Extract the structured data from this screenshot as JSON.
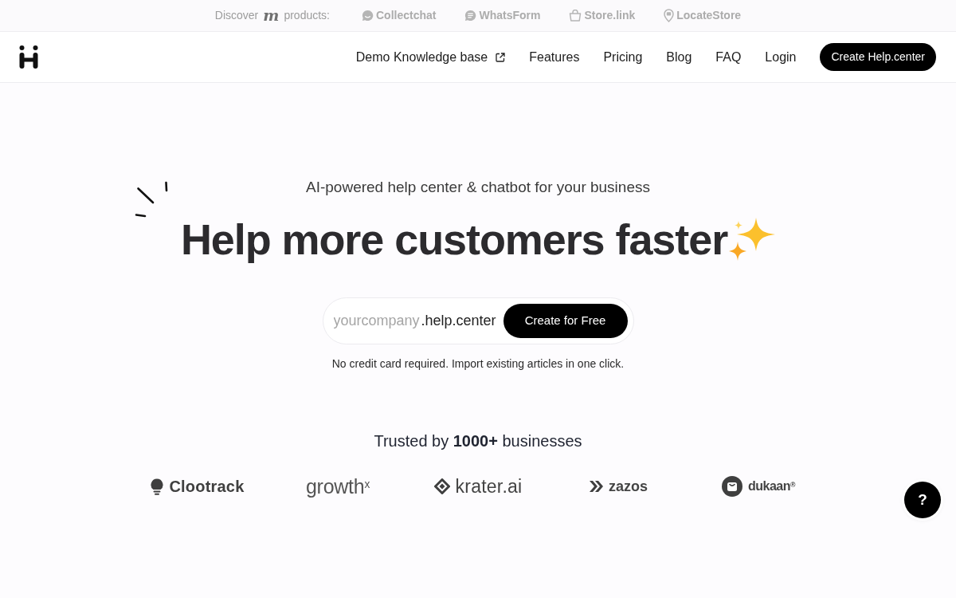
{
  "top_bar": {
    "discover_label": "Discover",
    "brand_mark": "m",
    "products_label": "products:",
    "products": [
      {
        "name": "Collectchat",
        "kind": "chat"
      },
      {
        "name": "WhatsForm",
        "kind": "form"
      },
      {
        "name": "Store.link",
        "kind": "bag"
      },
      {
        "name": "LocateStore",
        "kind": "pin"
      }
    ]
  },
  "nav": {
    "links": [
      {
        "label": "Demo Knowledge base",
        "external": true
      },
      {
        "label": "Features",
        "external": false
      },
      {
        "label": "Pricing",
        "external": false
      },
      {
        "label": "Blog",
        "external": false
      },
      {
        "label": "FAQ",
        "external": false
      },
      {
        "label": "Login",
        "external": false
      }
    ],
    "cta": "Create Help.center"
  },
  "hero": {
    "tagline": "AI-powered help center & chatbot for your business",
    "heading": "Help more customers faster",
    "signup": {
      "placeholder": "yourcompany",
      "suffix": ".help.center",
      "button": "Create for Free"
    },
    "note": "No credit card required. Import existing articles in one click."
  },
  "trusted": {
    "title": "Trusted by **1000+** businesses",
    "logos": [
      {
        "name": "Clootrack",
        "kind": "bulb"
      },
      {
        "name": "growth$^{x}$",
        "kind": "plain"
      },
      {
        "name": "krater.ai",
        "kind": "diamond"
      },
      {
        "name": "zazos",
        "kind": "chevrons"
      },
      {
        "name": "dukaan$^{®}$",
        "kind": "bag-circle"
      }
    ]
  },
  "help_button": {
    "label": "?"
  }
}
